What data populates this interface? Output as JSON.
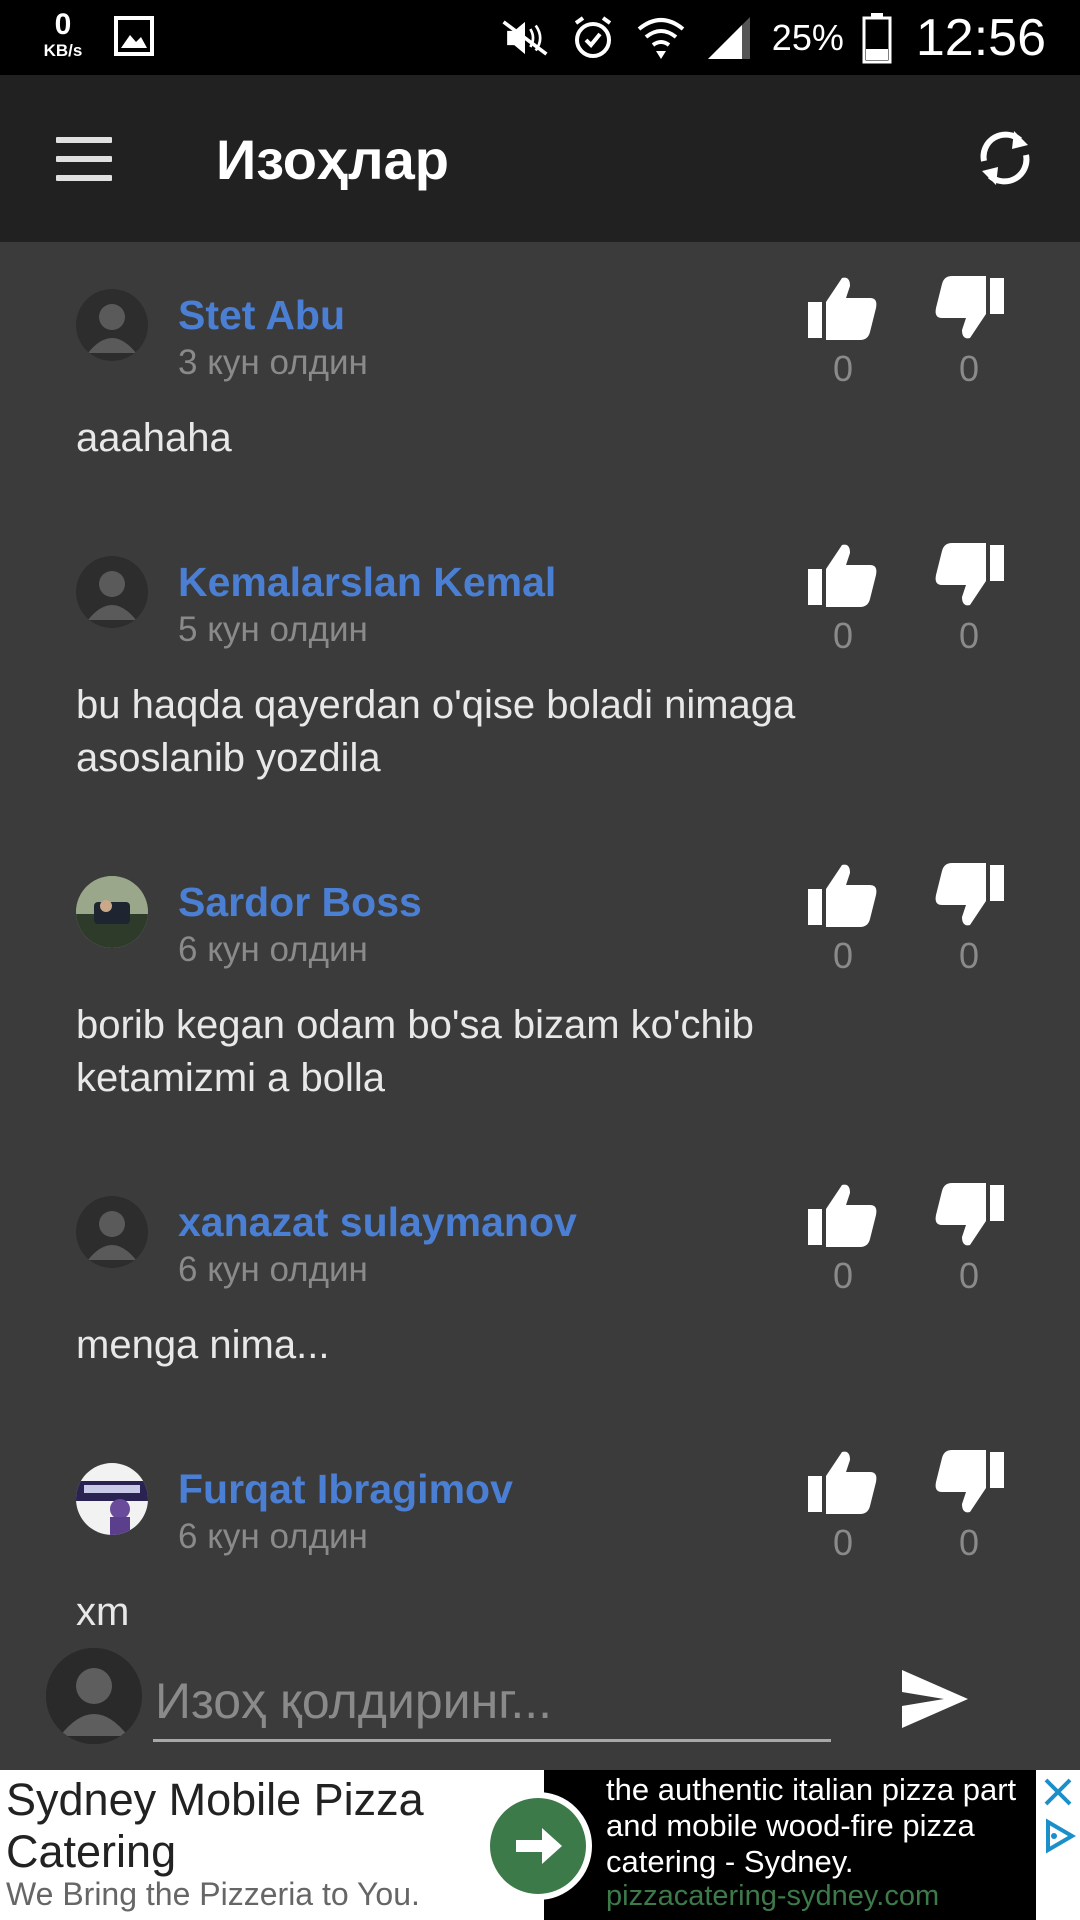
{
  "status_bar": {
    "net_speed": "0",
    "net_unit": "KB/s",
    "battery_percent": "25%",
    "time": "12:56",
    "icons": [
      "gallery-icon",
      "mute-icon",
      "alarm-icon",
      "wifi-icon",
      "signal-icon",
      "battery-icon"
    ]
  },
  "app_bar": {
    "title": "Изоҳлар",
    "icons": [
      "menu-icon",
      "refresh-icon"
    ]
  },
  "comments": [
    {
      "author": "Stet Abu",
      "time": "3 кун олдин",
      "text": "aaahaha",
      "likes": "0",
      "dislikes": "0",
      "avatar": "default"
    },
    {
      "author": "Kemalarslan Kemal",
      "time": "5 кун олдин",
      "text": "bu haqda qayerdan o'qise boladi nimaga asoslanib yozdila",
      "likes": "0",
      "dislikes": "0",
      "avatar": "default"
    },
    {
      "author": "Sardor Boss",
      "time": "6 кун олдин",
      "text": "borib kegan odam bo'sa bizam ko'chib ketamizmi a bolla",
      "likes": "0",
      "dislikes": "0",
      "avatar": "photo"
    },
    {
      "author": "xanazat sulaymanov",
      "time": "6 кун олдин",
      "text": "menga nima...",
      "likes": "0",
      "dislikes": "0",
      "avatar": "default"
    },
    {
      "author": "Furqat Ibragimov",
      "time": "6 кун олдин",
      "text": "xm",
      "likes": "0",
      "dislikes": "0",
      "avatar": "photo"
    }
  ],
  "input_bar": {
    "placeholder": "Изоҳ қолдиринг...",
    "value": ""
  },
  "ad": {
    "title": "Sydney Mobile Pizza Catering",
    "tagline": "We Bring the Pizzeria to You.",
    "description_lines": [
      "the authentic italian pizza part",
      "and mobile wood-fire pizza",
      "catering - Sydney."
    ],
    "url": "pizzacatering-sydney.com",
    "accent": "#3d7a4a"
  },
  "colors": {
    "background": "#3b3b3b",
    "app_bar": "#212121",
    "author": "#4a7fd4",
    "muted": "#8a8a8a"
  }
}
